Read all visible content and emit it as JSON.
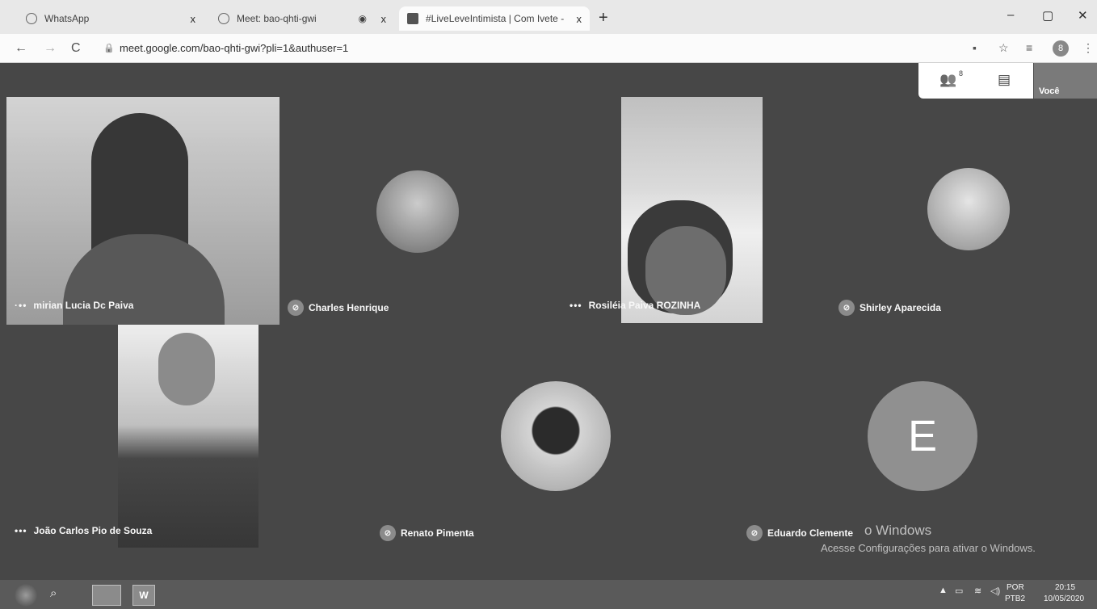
{
  "browser": {
    "tabs": [
      {
        "label": "WhatsApp",
        "close": "x"
      },
      {
        "label": "Meet: bao-qhti-gwi",
        "close": "x"
      },
      {
        "label": "#LiveLeveIntimista | Com Ivete -",
        "close": "x"
      }
    ],
    "new_tab": "+",
    "window_controls": {
      "minimize": "–",
      "maximize": "▢",
      "close": "✕"
    },
    "nav": {
      "back": "←",
      "forward": "→",
      "reload": "C"
    },
    "url": "meet.google.com/bao-qhti-gwi?pli=1&authuser=1",
    "profile_initial": "8"
  },
  "meet": {
    "people_icon": "people-icon",
    "people_count": "8",
    "chat_icon": "chat-icon",
    "self_label": "Você",
    "participants": [
      {
        "name": "mirian Lucia Dc Paiva",
        "indicator": "dots"
      },
      {
        "name": "Charles Henrique",
        "indicator": "mic-off"
      },
      {
        "name": "Rosiléia Paiva ROZINHA",
        "indicator": "dots"
      },
      {
        "name": "Shirley Aparecida",
        "indicator": "mic-off"
      },
      {
        "name": "João Carlos Pio de Souza",
        "indicator": "dots"
      },
      {
        "name": "Renato Pimenta",
        "indicator": "mic-off"
      },
      {
        "name": "Eduardo Clemente",
        "indicator": "mic-off",
        "initial": "E"
      }
    ],
    "activation": {
      "line1": "o Windows",
      "line2": "Acesse Configurações para ativar o Windows."
    }
  },
  "taskbar": {
    "word_label": "W",
    "language": "POR",
    "layout": "PTB2",
    "time": "20:15",
    "date": "10/05/2020"
  }
}
